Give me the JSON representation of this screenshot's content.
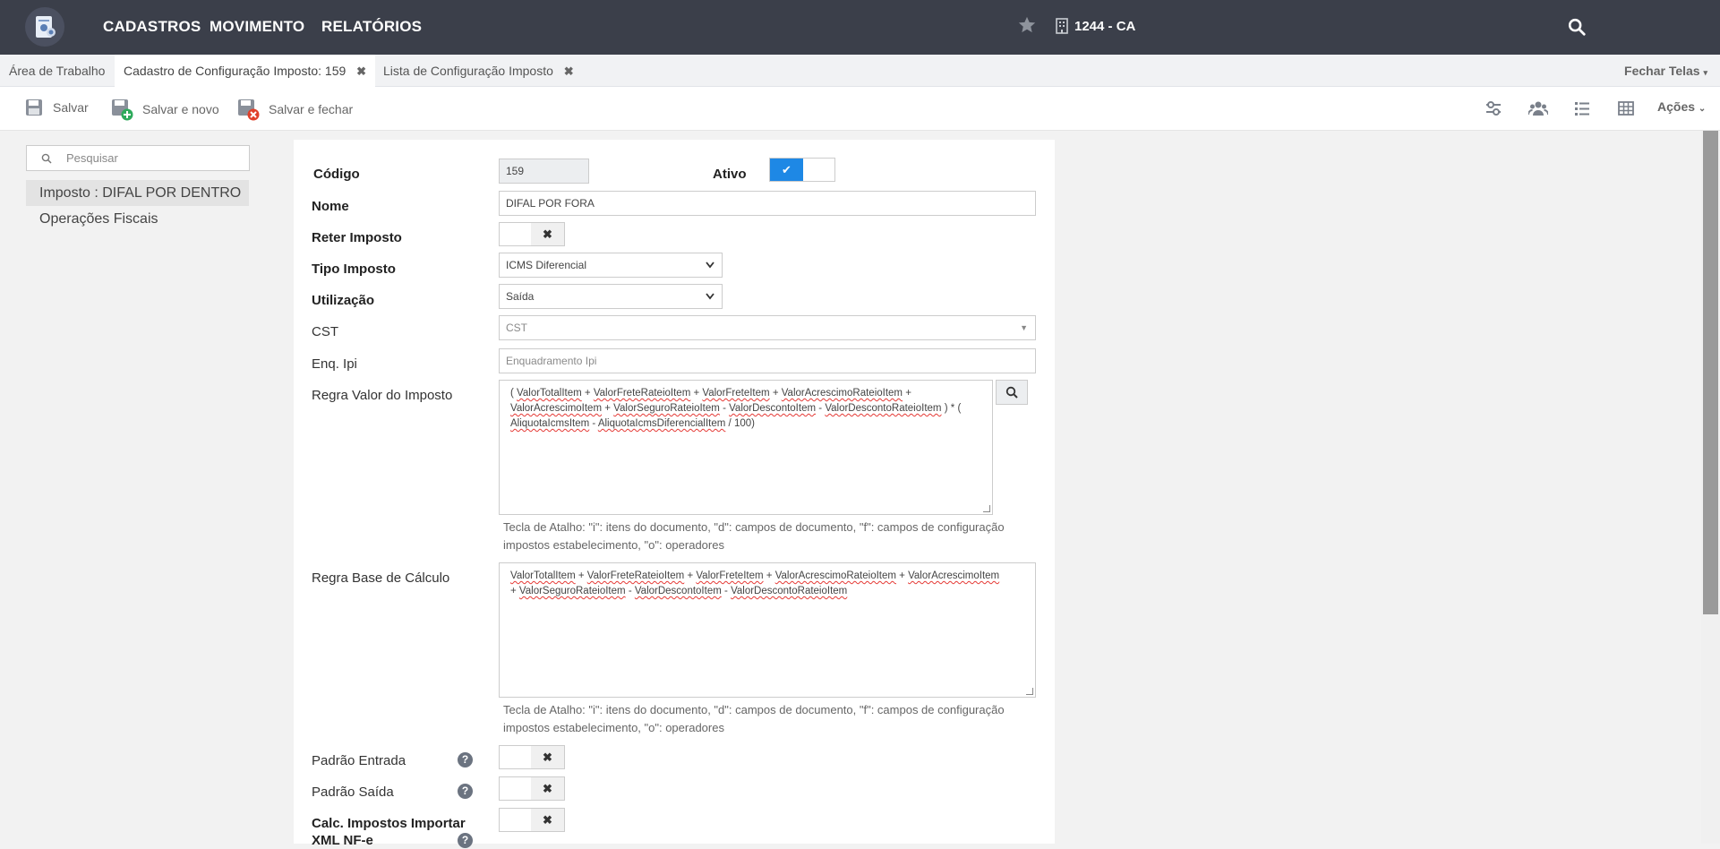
{
  "nav": {
    "items": [
      "CADASTROS",
      "MOVIMENTO",
      "RELATÓRIOS"
    ],
    "company": "1244 - CA"
  },
  "tabs": {
    "items": [
      {
        "label": "Área de Trabalho"
      },
      {
        "label": "Cadastro de Configuração Imposto: 159"
      },
      {
        "label": "Lista de Configuração Imposto"
      }
    ],
    "close_all": "Fechar Telas"
  },
  "toolbar": {
    "save_label": "Salvar",
    "save_new_label": "Salvar e novo",
    "save_close_label": "Salvar e fechar",
    "actions_label": "Ações"
  },
  "sidebar": {
    "search_placeholder": "Pesquisar",
    "items": [
      {
        "label": "Imposto : DIFAL POR DENTRO",
        "active": true
      },
      {
        "label": "Operações Fiscais",
        "active": false
      }
    ]
  },
  "form": {
    "codigo": {
      "label": "Código",
      "value": "159"
    },
    "ativo": {
      "label": "Ativo",
      "checked": true
    },
    "nome": {
      "label": "Nome",
      "value": "DIFAL POR FORA"
    },
    "reter_imposto": {
      "label": "Reter Imposto",
      "checked": false
    },
    "tipo_imposto": {
      "label": "Tipo Imposto",
      "value": "ICMS Diferencial"
    },
    "utilizacao": {
      "label": "Utilização",
      "value": "Saída"
    },
    "cst": {
      "label": "CST",
      "placeholder": "CST"
    },
    "enq_ipi": {
      "label": "Enq. Ipi",
      "placeholder": "Enquadramento Ipi"
    },
    "regra_valor": {
      "label": "Regra Valor do Imposto",
      "line1": "( ValorTotalItem + ValorFreteRateioItem + ValorFreteItem + ValorAcrescimoRateioItem +",
      "line2": "ValorAcrescimoItem + ValorSeguroRateioItem - ValorDescontoItem - ValorDescontoRateioItem ) * (",
      "line3": "AliquotaIcmsItem - AliquotaIcmsDiferencialItem / 100)"
    },
    "hint_line1": "Tecla de Atalho: \"i\": itens do documento, \"d\": campos de documento, \"f\": campos de configuração",
    "hint_line2": "impostos estabelecimento, \"o\": operadores",
    "regra_base": {
      "label": "Regra Base de Cálculo",
      "line1": "ValorTotalItem + ValorFreteRateioItem + ValorFreteItem + ValorAcrescimoRateioItem + ValorAcrescimoItem",
      "line2": "+ ValorSeguroRateioItem - ValorDescontoItem - ValorDescontoRateioItem"
    },
    "padrao_entrada": {
      "label": "Padrão Entrada",
      "checked": false
    },
    "padrao_saida": {
      "label": "Padrão Saída",
      "checked": false
    },
    "calc_impostos": {
      "label_line1": "Calc. Impostos Importar",
      "label_line2": "XML NF-e",
      "checked": false
    }
  },
  "colors": {
    "topbar": "#3b3f4a",
    "toggle_on": "#1e88e5"
  }
}
